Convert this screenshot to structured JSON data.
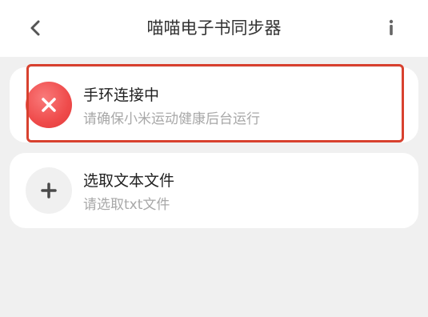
{
  "header": {
    "title": "喵喵电子书同步器",
    "back_icon": "chevron-left-icon",
    "info_icon": "info-icon"
  },
  "status_card": {
    "title": "手环连接中",
    "subtitle": "请确保小米运动健康后台运行",
    "icon": "close-x-icon",
    "icon_color": "#ef4b4b"
  },
  "file_card": {
    "title": "选取文本文件",
    "subtitle": "请选取txt文件",
    "icon": "plus-icon"
  },
  "colors": {
    "background": "#f0f0f0",
    "card": "#ffffff",
    "highlight": "#d8412f"
  }
}
